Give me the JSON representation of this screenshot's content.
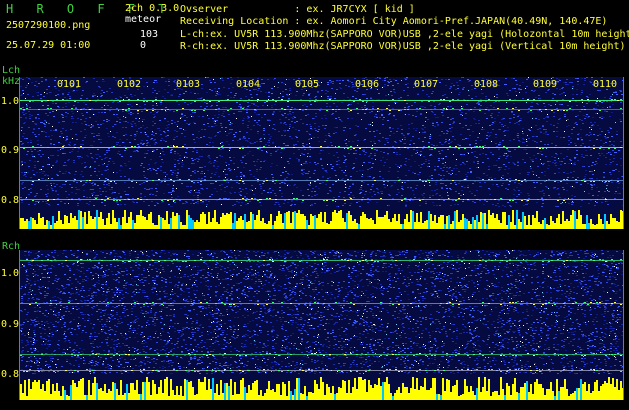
{
  "header": {
    "app_title": "H R O F F T",
    "version": "2ch 0.3.0",
    "mode": "meteor",
    "file_name": "2507290100.png",
    "date_time": "25.07.29 01:00",
    "count_a": "103",
    "count_b": "0"
  },
  "info": {
    "observer": "Ovserver           : ex. JR7CYX [ kid ]",
    "location": "Receiving Location : ex. Aomori City Aomori-Pref.JAPAN(40.49N, 140.47E)",
    "lch": "L-ch:ex. UV5R 113.900Mhz(SAPPORO VOR)USB ,2-ele yagi (Holozontal 10m height)",
    "rch": "R-ch:ex. UV5R 113.900Mhz(SAPPORO VOR)USB ,2-ele yagi (Vertical 10m height)"
  },
  "lch": {
    "label": "Lch",
    "unit": "kHz",
    "ticks": [
      "1.0",
      "0.9",
      "0.8"
    ]
  },
  "rch": {
    "label": "Rch",
    "ticks": [
      "1.0",
      "0.9",
      "0.8"
    ]
  },
  "time_labels": [
    "0101",
    "0102",
    "0103",
    "0104",
    "0105",
    "0106",
    "0107",
    "0108",
    "0109",
    "0110"
  ],
  "colors": {
    "background": "#000000",
    "label_yellow": "#ffff33",
    "label_green": "#3fd23f",
    "waterfall_noise": "#1a2aa8",
    "signal_level": "#ffff00",
    "signal_level_alt": "#00c8ff"
  }
}
